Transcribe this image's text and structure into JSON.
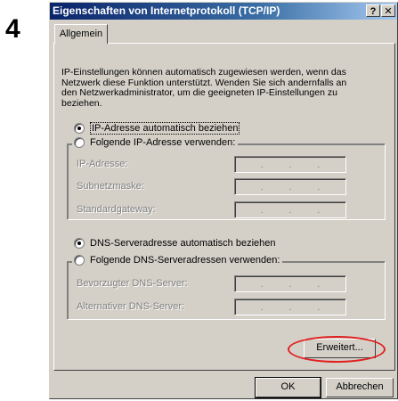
{
  "step_number": "4",
  "window": {
    "title": "Eigenschaften von Internetprotokoll (TCP/IP)",
    "help_glyph": "?",
    "close_glyph": "✕"
  },
  "tabs": [
    {
      "label": "Allgemein",
      "selected": true
    }
  ],
  "intro_text": "IP-Einstellungen können automatisch zugewiesen werden, wenn das Netzwerk diese Funktion unterstützt. Wenden Sie sich andernfalls an den Netzwerkadministrator, um die geeigneten IP-Einstellungen zu beziehen.",
  "ip_section": {
    "auto_option": {
      "label": "IP-Adresse automatisch beziehen",
      "checked": true
    },
    "manual_option": {
      "label": "Folgende IP-Adresse verwenden:",
      "checked": false
    },
    "fields": [
      {
        "label": "IP-Adresse:",
        "value": ". . ."
      },
      {
        "label": "Subnetzmaske:",
        "value": ". . ."
      },
      {
        "label": "Standardgateway:",
        "value": ". . ."
      }
    ]
  },
  "dns_section": {
    "auto_option": {
      "label": "DNS-Serveradresse automatisch beziehen",
      "checked": true
    },
    "manual_option": {
      "label": "Folgende DNS-Serveradressen verwenden:",
      "checked": false
    },
    "fields": [
      {
        "label": "Bevorzugter DNS-Server:",
        "value": ". . ."
      },
      {
        "label": "Alternativer DNS-Server:",
        "value": ". . ."
      }
    ]
  },
  "buttons": {
    "advanced": "Erweitert...",
    "ok": "OK",
    "cancel": "Abbrechen"
  },
  "colors": {
    "highlight_ring": "#e02020",
    "titlebar_start": "#0a246a",
    "titlebar_end": "#a6caf0"
  }
}
